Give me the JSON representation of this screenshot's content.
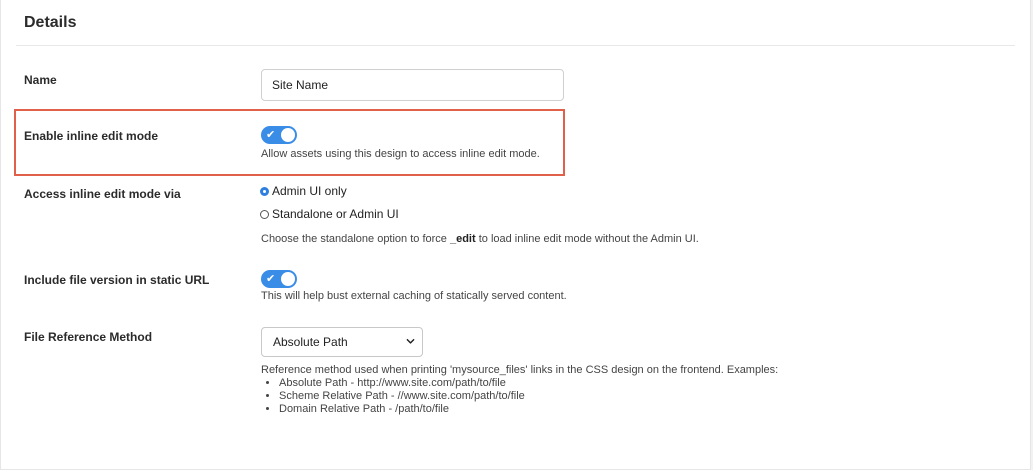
{
  "section": {
    "title": "Details"
  },
  "fields": {
    "name": {
      "label": "Name",
      "value": "Site Name"
    },
    "inline_edit": {
      "label": "Enable inline edit mode",
      "enabled": true,
      "help": "Allow assets using this design to access inline edit mode."
    },
    "access_via": {
      "label": "Access inline edit mode via",
      "options": [
        "Admin UI only",
        "Standalone or Admin UI"
      ],
      "selected": "Admin UI only",
      "help_prefix": "Choose the standalone option to force ",
      "help_keyword": "_edit",
      "help_suffix": " to load inline edit mode without the Admin UI."
    },
    "file_version": {
      "label": "Include file version in static URL",
      "enabled": true,
      "help": "This will help bust external caching of statically served content."
    },
    "reference_method": {
      "label": "File Reference Method",
      "selected": "Absolute Path",
      "help": "Reference method used when printing 'mysource_files' links in the CSS design on the frontend. Examples:",
      "examples": [
        "Absolute Path - http://www.site.com/path/to/file",
        "Scheme Relative Path - //www.site.com/path/to/file",
        "Domain Relative Path - /path/to/file"
      ]
    }
  },
  "colors": {
    "accent": "#3a8de6",
    "highlight": "#e0604a"
  }
}
